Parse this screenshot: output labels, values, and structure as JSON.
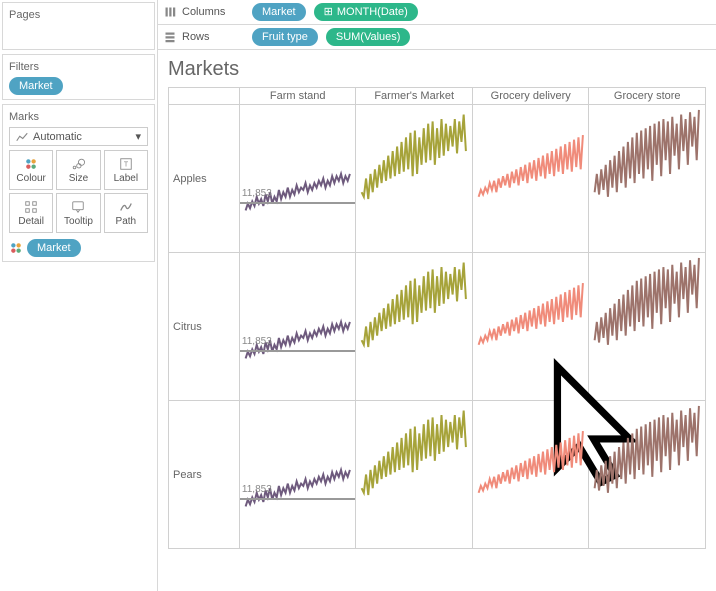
{
  "sidebar": {
    "pages_title": "Pages",
    "filters_title": "Filters",
    "filter_pill": "Market",
    "marks_title": "Marks",
    "marks_mode": "Automatic",
    "buttons": {
      "colour": "Colour",
      "size": "Size",
      "label": "Label",
      "detail": "Detail",
      "tooltip": "Tooltip",
      "path": "Path"
    },
    "legend_pill": "Market"
  },
  "shelves": {
    "columns_label": "Columns",
    "rows_label": "Rows",
    "col_pill1": "Market",
    "col_pill2": "MONTH(Date)",
    "row_pill1": "Fruit type",
    "row_pill2": "SUM(Values)"
  },
  "chart": {
    "title": "Markets",
    "col_headers": [
      "Farm stand",
      "Farmer's Market",
      "Grocery delivery",
      "Grocery store"
    ],
    "row_headers": [
      "Apples",
      "Citrus",
      "Pears"
    ],
    "baseline_label": "11,853"
  },
  "colors": {
    "farm": "#6e5a7d",
    "farmers": "#a6a33a",
    "grocerydel": "#f08b7a",
    "grocerystore": "#9d736b"
  },
  "chart_data": {
    "type": "line",
    "title": "Markets",
    "trellis_rows": [
      "Apples",
      "Citrus",
      "Pears"
    ],
    "trellis_cols": [
      "Farm stand",
      "Farmer's Market",
      "Grocery delivery",
      "Grocery store"
    ],
    "x": "month index (0-47)",
    "y": "SUM(Values)",
    "baseline": 11853,
    "ylim": [
      0,
      30000
    ],
    "comment": "approximate values read from sparklines; same pattern per column across fruit rows",
    "series_by_column": {
      "Farm stand": [
        8000,
        9500,
        8500,
        10000,
        9000,
        11000,
        9500,
        10500,
        9000,
        11500,
        10000,
        12000,
        9500,
        11000,
        10000,
        12500,
        10500,
        12000,
        11000,
        13000,
        11000,
        12500,
        11500,
        13500,
        12000,
        13000,
        12500,
        14000,
        12000,
        13500,
        12500,
        14000,
        13000,
        14500,
        13500,
        15000,
        13000,
        14500,
        13500,
        15500,
        14000,
        15500,
        14500,
        16000,
        14000,
        15500,
        14500,
        16000
      ],
      "Farmer's Market": [
        12000,
        11000,
        15000,
        10500,
        16000,
        12000,
        17000,
        13000,
        18000,
        14000,
        19000,
        14500,
        20000,
        15000,
        21000,
        15500,
        22000,
        16000,
        23000,
        16500,
        24000,
        17000,
        25000,
        15500,
        25500,
        16000,
        24000,
        18000,
        26000,
        18500,
        27000,
        19000,
        27500,
        18000,
        26000,
        19500,
        28000,
        20000,
        27000,
        21000,
        26500,
        22000,
        28000,
        20500,
        27500,
        23000,
        29000,
        21000
      ],
      "Grocery delivery": [
        11000,
        12500,
        11500,
        13000,
        12000,
        14000,
        12500,
        14500,
        12000,
        15000,
        13000,
        15500,
        13500,
        16000,
        13000,
        16500,
        14000,
        17000,
        13500,
        17500,
        14500,
        18000,
        14000,
        18500,
        15000,
        19000,
        14500,
        19500,
        15500,
        20000,
        15000,
        20500,
        16000,
        21000,
        15500,
        21500,
        16500,
        22000,
        16000,
        22500,
        17000,
        23000,
        16500,
        23500,
        17500,
        24000,
        17000,
        24500
      ],
      "Grocery store": [
        12000,
        16000,
        11500,
        17000,
        12500,
        18000,
        11000,
        19000,
        13000,
        20000,
        12000,
        21000,
        14000,
        22000,
        13000,
        23000,
        15000,
        24000,
        14000,
        25000,
        16000,
        25500,
        15000,
        26000,
        17000,
        26500,
        14500,
        27000,
        18000,
        27500,
        15500,
        28000,
        19000,
        27500,
        16000,
        28500,
        20000,
        27000,
        17000,
        29000,
        21000,
        28000,
        18000,
        29500,
        22000,
        28500,
        19000,
        30000
      ]
    }
  }
}
